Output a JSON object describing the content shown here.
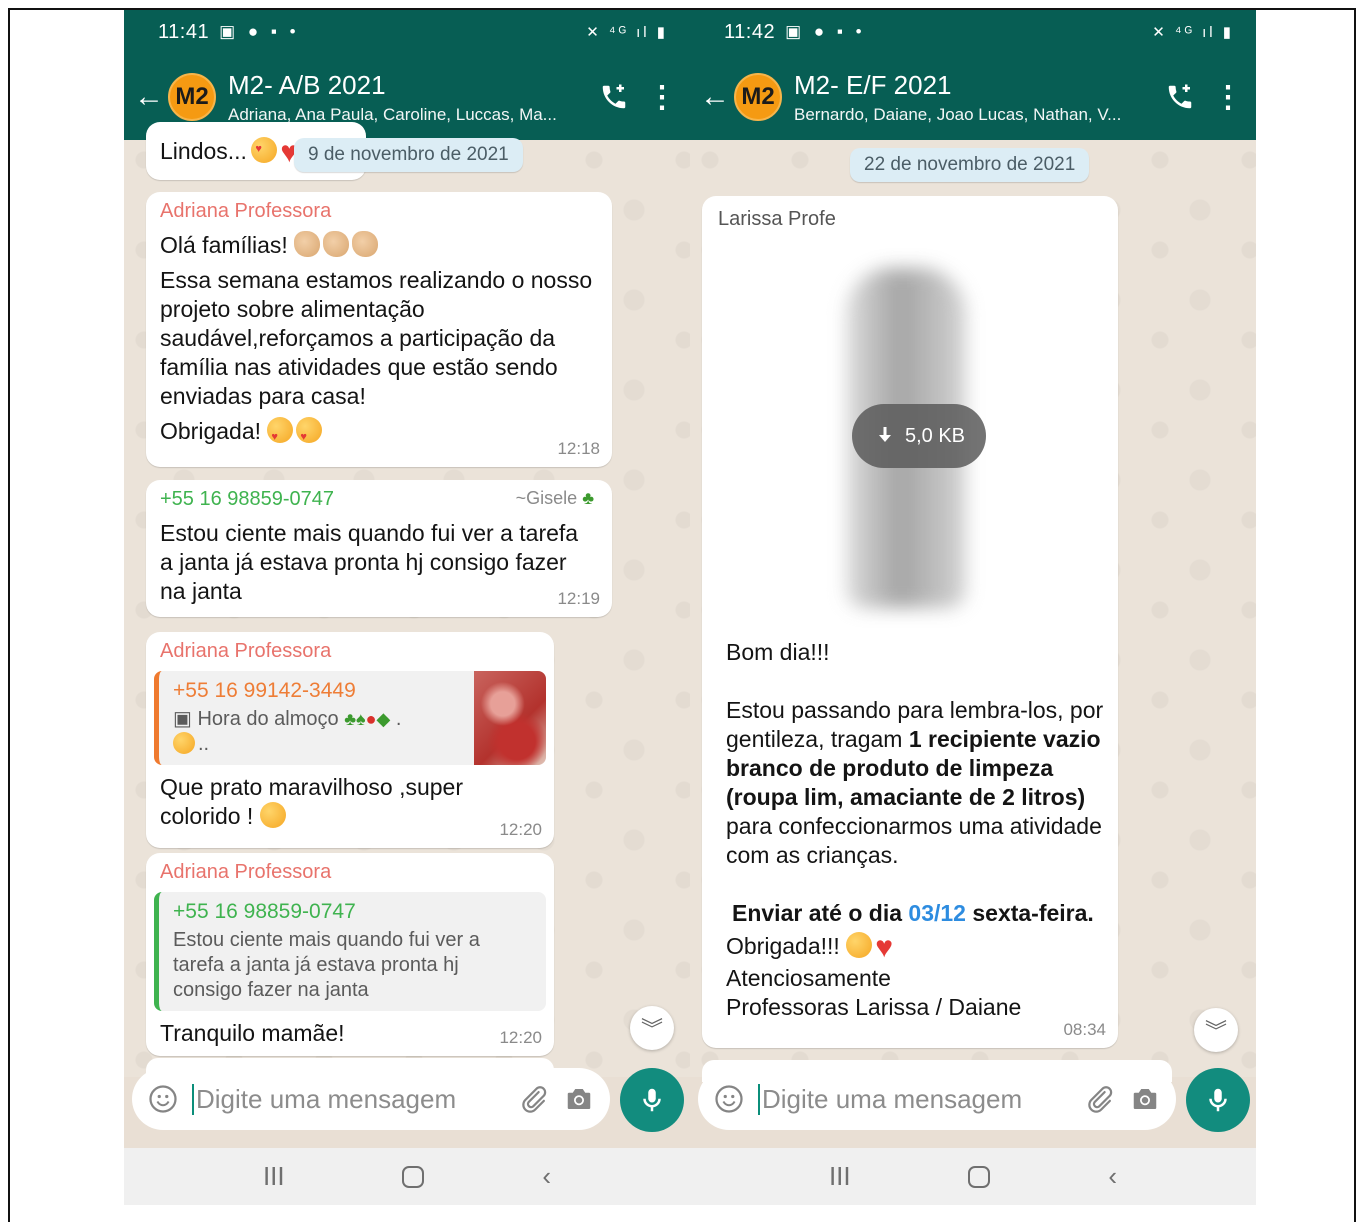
{
  "phones": [
    {
      "status": {
        "time": "11:41",
        "left_icons": "▣ ● ▪ •",
        "right_icons": "✕ ⁴ᴳ ıl ▮"
      },
      "header": {
        "back": "←",
        "avatar": "M2",
        "title": "M2- A/B 2021",
        "subtitle": "Adriana, Ana Paula, Caroline, Luccas, Ma..."
      },
      "date_chip": "9 de novembro de 2021",
      "partial_top_text": "Lindos...",
      "messages": [
        {
          "sender": "Adriana Professora",
          "greeting": "Olá famílias!",
          "body": " Essa semana estamos realizando o nosso projeto sobre alimentação saudável,reforçamos a participação da família nas atividades que estão sendo enviadas para casa!",
          "closing": "Obrigada!",
          "time": "12:18"
        },
        {
          "sender": "+55 16 98859-0747",
          "alias": "~Gisele",
          "body": "Estou ciente mais quando fui ver a tarefa a janta já estava pronta hj consigo fazer na janta",
          "time": "12:19"
        },
        {
          "sender": "Adriana Professora",
          "quote_name": "+55 16 99142-3449",
          "quote_text": "Hora do almoço",
          "quote_tail": "..",
          "body": "Que prato maravilhoso ,super colorido !",
          "time": "12:20"
        },
        {
          "sender": "Adriana Professora",
          "quote_name": "+55 16 98859-0747",
          "quote_text": "Estou ciente mais quando fui ver a tarefa a janta já estava pronta hj consigo fazer na janta",
          "body": "Tranquilo mamãe!",
          "time": "12:20"
        }
      ],
      "input_placeholder": "Digite uma mensagem"
    },
    {
      "status": {
        "time": "11:42",
        "left_icons": "▣ ● ▪ •",
        "right_icons": "✕ ⁴ᴳ ıl ▮"
      },
      "header": {
        "back": "←",
        "avatar": "M2",
        "title": "M2- E/F 2021",
        "subtitle": "Bernardo, Daiane, Joao Lucas, Nathan, V..."
      },
      "date_chip": "22 de novembro de 2021",
      "message": {
        "sender": "Larissa Profe",
        "download_size": "5,0 KB",
        "line1": "Bom dia!!!",
        "p2_a": "Estou passando para lembra-los, por gentileza, tragam ",
        "p2_bold": "1 recipiente vazio branco de produto de limpeza (roupa lim, amaciante de 2 litros)",
        "p2_c": " para confeccionarmos uma atividade com as crianças.",
        "deadline_a": "Enviar até o dia ",
        "deadline_date": "03/12",
        "deadline_b": " sexta-feira.",
        "thanks": "Obrigada!!!",
        "regards": "Atenciosamente",
        "signature": "Professoras Larissa / Daiane",
        "time": "08:34"
      },
      "input_placeholder": "Digite uma mensagem"
    }
  ],
  "nav": {
    "recents": "III",
    "back": "‹"
  },
  "colors": {
    "header": "#075e54",
    "accent": "#128c7e",
    "sender_red": "#e8736c",
    "sender_green": "#3fb34f",
    "quote_orange": "#ee7d36",
    "link": "#2d8ce0"
  },
  "icons": [
    "back-arrow-icon",
    "add-call-icon",
    "more-vert-icon",
    "emoji-icon",
    "attach-icon",
    "camera-icon",
    "mic-icon",
    "download-icon",
    "scroll-down-icon"
  ]
}
